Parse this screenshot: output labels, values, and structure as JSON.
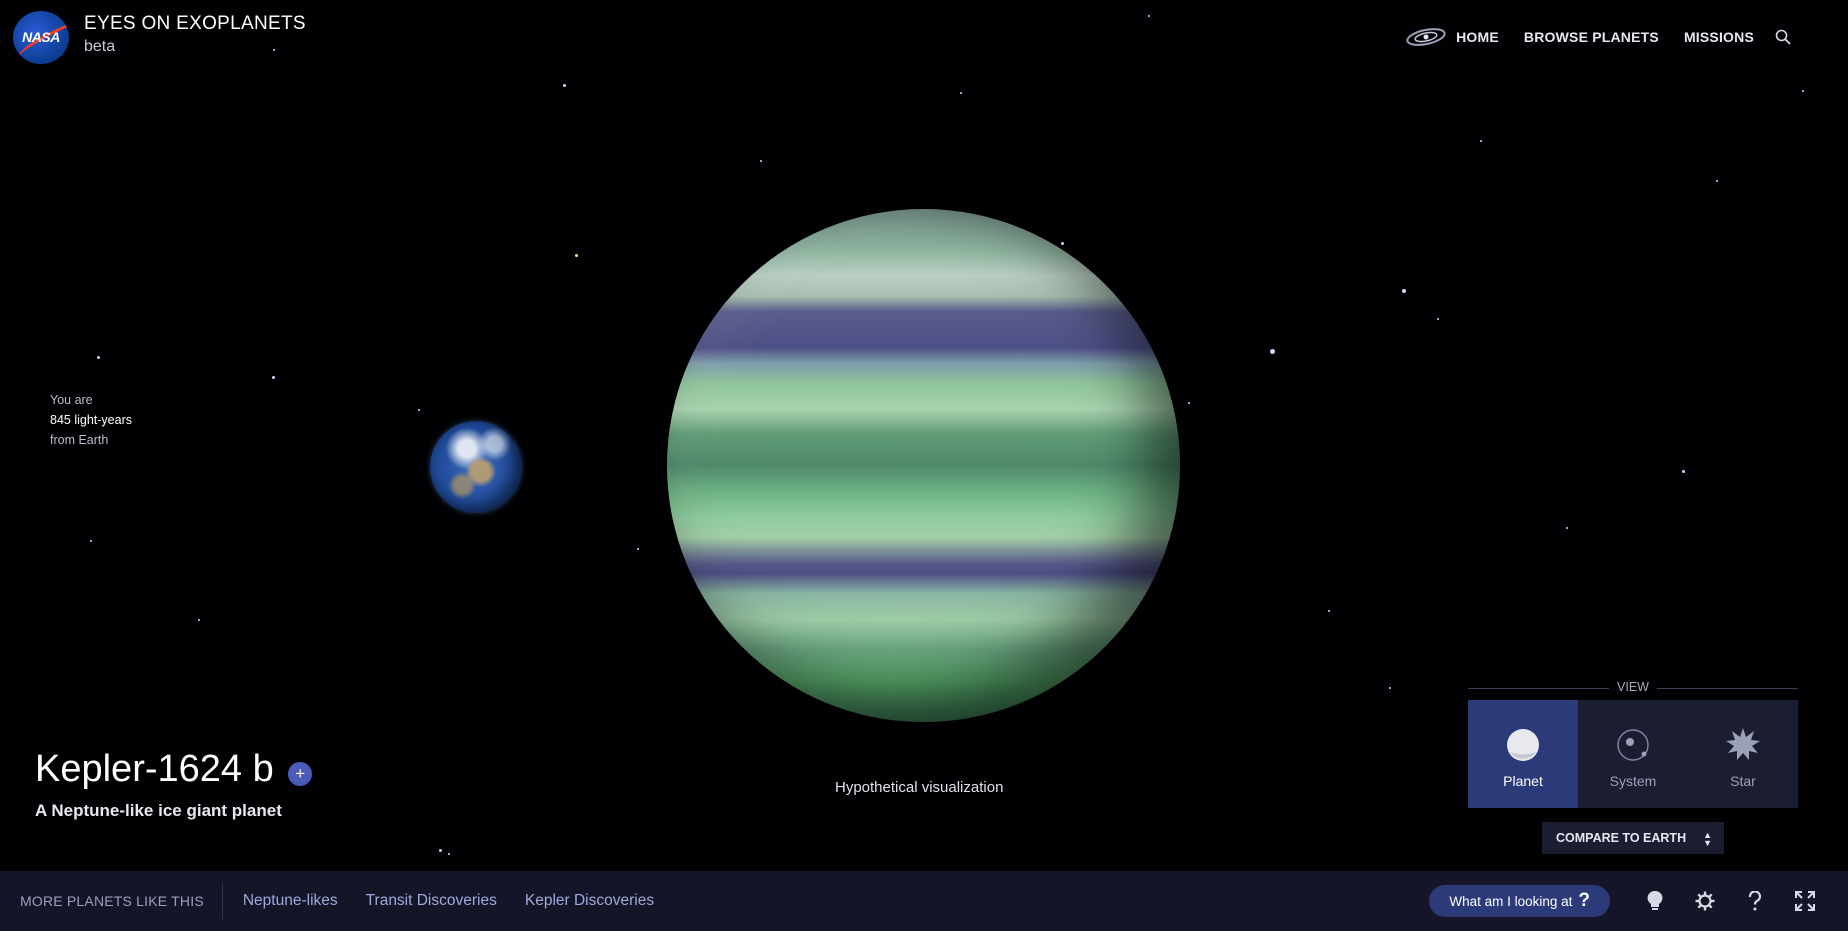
{
  "header": {
    "logo_text": "NASA",
    "title": "EYES ON EXOPLANETS",
    "subtitle": "beta"
  },
  "nav": {
    "items": [
      "HOME",
      "BROWSE PLANETS",
      "MISSIONS"
    ],
    "icons": [
      "galaxy-icon",
      "search-icon"
    ]
  },
  "distance": {
    "prefix": "You are",
    "value": "845 light-years",
    "suffix": "from Earth"
  },
  "planet": {
    "name": "Kepler-1624 b",
    "add_label": "+",
    "description": "A Neptune-like ice giant planet",
    "caption": "Hypothetical visualization"
  },
  "view": {
    "label": "VIEW",
    "options": [
      "Planet",
      "System",
      "Star"
    ],
    "selected": "Planet",
    "compare_label": "COMPARE TO EARTH"
  },
  "bottom": {
    "more_label": "MORE PLANETS LIKE THIS",
    "categories": [
      "Neptune-likes",
      "Transit Discoveries",
      "Kepler Discoveries"
    ],
    "what_label": "What am I looking at",
    "what_icon": "?",
    "tools": [
      "lightbulb-icon",
      "settings-icon",
      "help-icon",
      "fullscreen-icon"
    ]
  },
  "colors": {
    "background": "#010103",
    "bar": "#141627",
    "accent": "#2d3a7a",
    "link": "#9fa9dd",
    "nasa_blue": "#0b3d91",
    "nasa_red": "#fc3d21"
  }
}
